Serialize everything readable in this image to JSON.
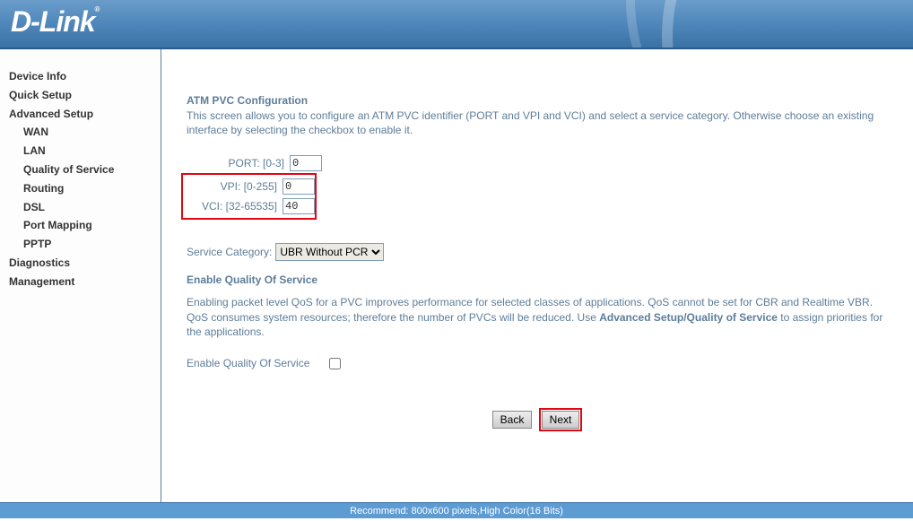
{
  "brand": "D-Link",
  "sidebar": {
    "items": [
      {
        "label": "Device Info",
        "sub": false
      },
      {
        "label": "Quick Setup",
        "sub": false
      },
      {
        "label": "Advanced Setup",
        "sub": false
      },
      {
        "label": "WAN",
        "sub": true
      },
      {
        "label": "LAN",
        "sub": true
      },
      {
        "label": "Quality of Service",
        "sub": true
      },
      {
        "label": "Routing",
        "sub": true
      },
      {
        "label": "DSL",
        "sub": true
      },
      {
        "label": "Port Mapping",
        "sub": true
      },
      {
        "label": "PPTP",
        "sub": true
      },
      {
        "label": "Diagnostics",
        "sub": false
      },
      {
        "label": "Management",
        "sub": false
      }
    ]
  },
  "page": {
    "title": "ATM PVC Configuration",
    "description": "This screen allows you to configure an ATM PVC identifier (PORT and VPI and VCI) and select a service category. Otherwise choose an existing interface by selecting the checkbox to enable it.",
    "port_label": "PORT: [0-3]",
    "port_value": "0",
    "vpi_label": "VPI: [0-255]",
    "vpi_value": "0",
    "vci_label": "VCI: [32-65535]",
    "vci_value": "40",
    "service_label": "Service Category:",
    "service_value": "UBR Without PCR",
    "qos_title": "Enable Quality Of Service",
    "qos_desc_1": "Enabling packet level QoS for a PVC improves performance for selected classes of applications.  QoS cannot be set for CBR and Realtime VBR.  QoS consumes system resources; therefore the number of PVCs will be reduced. Use ",
    "qos_desc_strong": "Advanced Setup/Quality of Service",
    "qos_desc_2": " to assign priorities for the applications.",
    "enable_label": "Enable Quality Of Service",
    "back_label": "Back",
    "next_label": "Next"
  },
  "footer": "Recommend: 800x600 pixels,High Color(16 Bits)"
}
